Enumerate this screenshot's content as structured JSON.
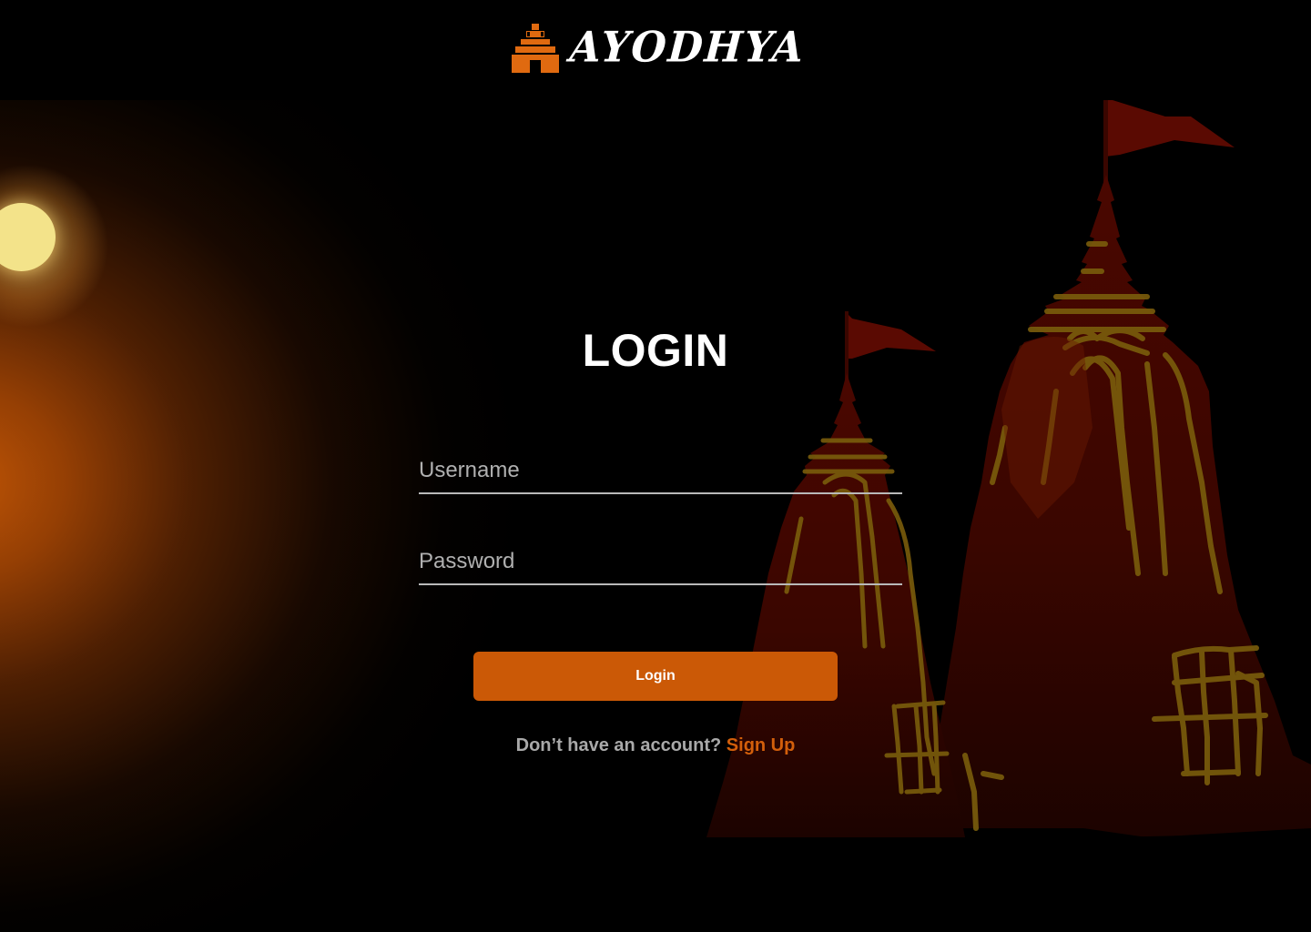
{
  "brand": {
    "name": "AYODHYA",
    "icon": "temple-icon",
    "icon_color": "#e06a10"
  },
  "login": {
    "title": "LOGIN",
    "username_placeholder": "Username",
    "password_placeholder": "Password",
    "button_label": "Login",
    "signup_prompt": "Don’t have an account?",
    "signup_link": "Sign Up"
  },
  "colors": {
    "accent": "#cb5906",
    "background": "#000000",
    "sun": "#f3e38a",
    "temple": "#3a0600",
    "temple_lines": "#7a5d0c"
  }
}
